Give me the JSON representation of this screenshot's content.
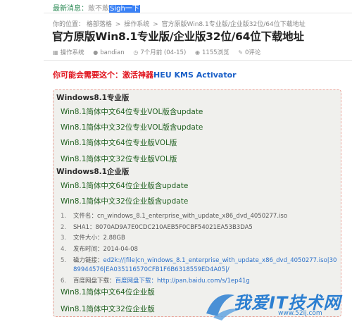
{
  "notice": {
    "label": "最新消息：",
    "text": "敢不敢",
    "highlight": "Sigh一下"
  },
  "breadcrumb": {
    "prefix": "你的位置：",
    "items": [
      "格部落格",
      "操作系统",
      "官方原版Win8.1专业版/企业版32位/64位下载地址"
    ],
    "separator": ">"
  },
  "title": "官方原版Win8.1专业版/企业版32位/64位下载地址",
  "meta": {
    "category": "操作系统",
    "author": "bandian",
    "time": "7个月前 (04-15)",
    "views": "1155浏览",
    "comments": "0评论"
  },
  "promo": {
    "text": "你可能会需要这个：激活神器",
    "link": "HEU KMS Activator"
  },
  "sections": [
    {
      "heading": "Windows8.1专业版",
      "links": [
        "Win8.1简体中文64位专业VOL版含update",
        "Win8.1简体中文32位专业VOL版含update",
        "Win8.1简体中文64位专业版VOL版",
        "Win8.1简体中文32位专业版VOL版"
      ]
    },
    {
      "heading": "Windows8.1企业版",
      "links": [
        "Win8.1简体中文64位企业版含update",
        "Win8.1简体中文32位企业版含update"
      ]
    }
  ],
  "details": [
    {
      "num": "1.",
      "text": "文件名：cn_windows_8.1_enterprise_with_update_x86_dvd_4050277.iso"
    },
    {
      "num": "2.",
      "text": "SHA1：8070AD9A7E0CDC210AEB5F0CBF54021EA53B3DA5"
    },
    {
      "num": "3.",
      "text": "文件大小：2.88GB"
    },
    {
      "num": "4.",
      "text": "发布时间：2014-04-08"
    },
    {
      "num": "5.",
      "text": "磁力链接：",
      "link": "ed2k://|file|cn_windows_8.1_enterprise_with_update_x86_dvd_4050277.iso|3089944576|EA035116570CFB1F6B6318559ED4A05|/"
    },
    {
      "num": "6.",
      "text": "百度网盘下载：",
      "link": "百度网盘下载：http://pan.baidu.com/s/1ep41g"
    }
  ],
  "after_links": [
    "Win8.1简体中文64位企业版",
    "Win8.1简体中文32位企业版"
  ],
  "watermark": {
    "main": "我爱IT技术网",
    "sub": "www.52ij.com"
  },
  "colors": {
    "accent": "#e0151f",
    "link": "#1a5fc7",
    "download": "#1f5f1f",
    "box_border": "#e9a49a",
    "box_bg": "#f0f0ed"
  },
  "icons": [
    "folder-icon",
    "user-icon",
    "clock-icon",
    "eye-icon",
    "comment-icon"
  ]
}
